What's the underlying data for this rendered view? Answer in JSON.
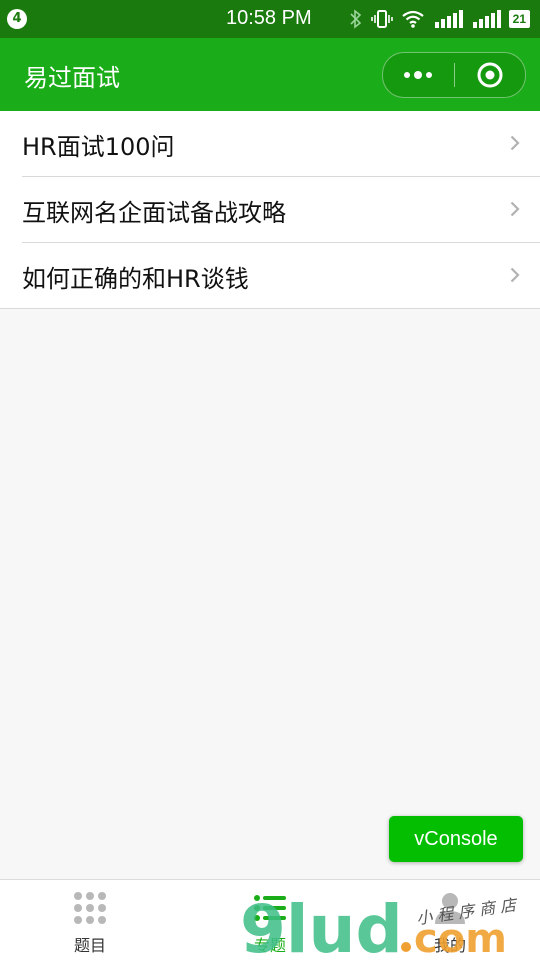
{
  "status_bar": {
    "notification_count": "4",
    "time": "10:58 PM",
    "battery": "21"
  },
  "nav": {
    "title": "易过面试"
  },
  "list": [
    {
      "label": "HR面试100问"
    },
    {
      "label": "互联网名企面试备战攻略"
    },
    {
      "label": "如何正确的和HR谈钱"
    }
  ],
  "vconsole": {
    "label": "vConsole"
  },
  "tabs": [
    {
      "label": "题目",
      "icon": "grid-dots-icon",
      "active": false
    },
    {
      "label": "专题",
      "icon": "list-icon",
      "active": true
    },
    {
      "label": "我的",
      "icon": "person-icon",
      "active": false
    }
  ],
  "watermark": {
    "text": "9lud.com",
    "subtext": "小程序商店"
  },
  "colors": {
    "status_bar": "#1a7a0d",
    "nav_bar": "#1aad19",
    "vconsole": "#04be02",
    "tab_active": "#1aad19"
  }
}
